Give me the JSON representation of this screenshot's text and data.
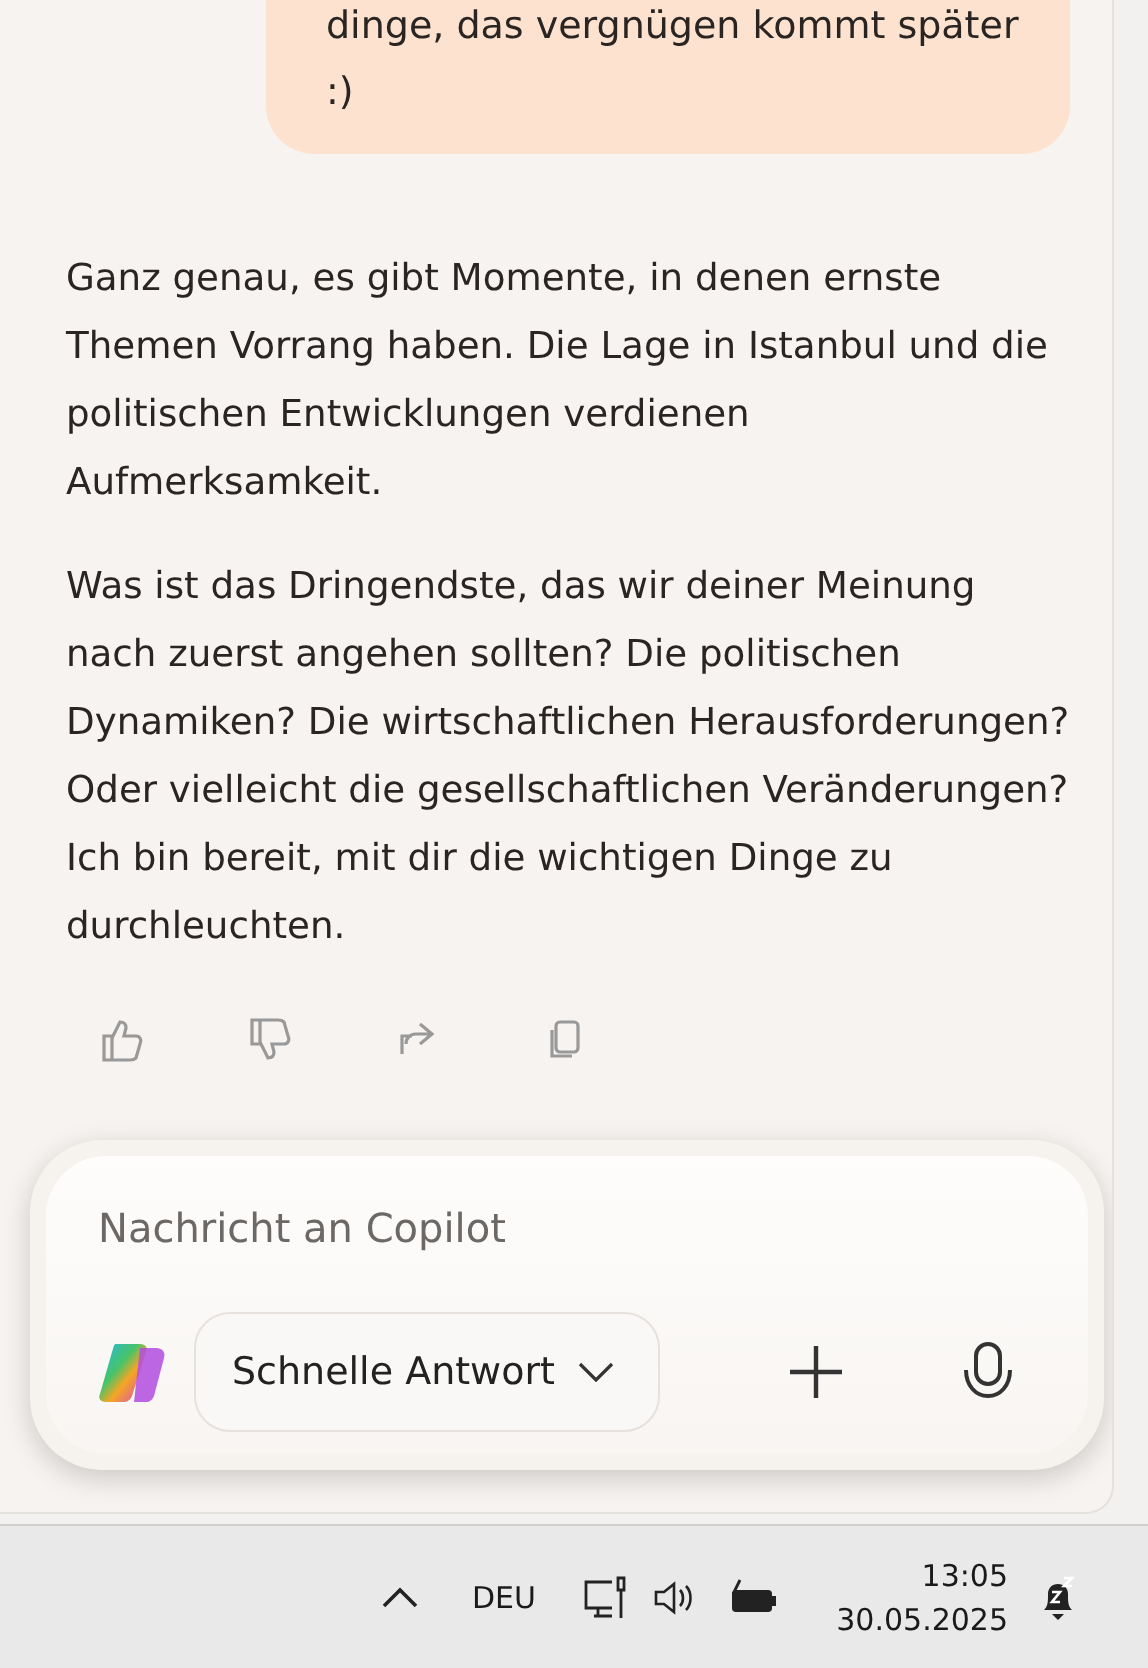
{
  "user_message": {
    "text": "dinge, das vergnügen kommt später :)"
  },
  "assistant_message": {
    "paragraphs": [
      "Ganz genau, es gibt Momente, in denen ernste Themen Vorrang haben. Die Lage in Istanbul und die politischen Entwicklungen verdienen Aufmerksamkeit.",
      "Was ist das Dringendste, das wir deiner Meinung nach zuerst angehen sollten? Die politischen Dynamiken? Die wirtschaftlichen Herausforderungen? Oder vielleicht die gesellschaftlichen Veränderungen? Ich bin bereit, mit dir die wichtigen Dinge zu durchleuchten."
    ]
  },
  "composer": {
    "placeholder": "Nachricht an Copilot",
    "mode_button": "Schnelle Antwort"
  },
  "taskbar": {
    "language": "DEU",
    "time": "13:05",
    "date": "30.05.2025"
  }
}
